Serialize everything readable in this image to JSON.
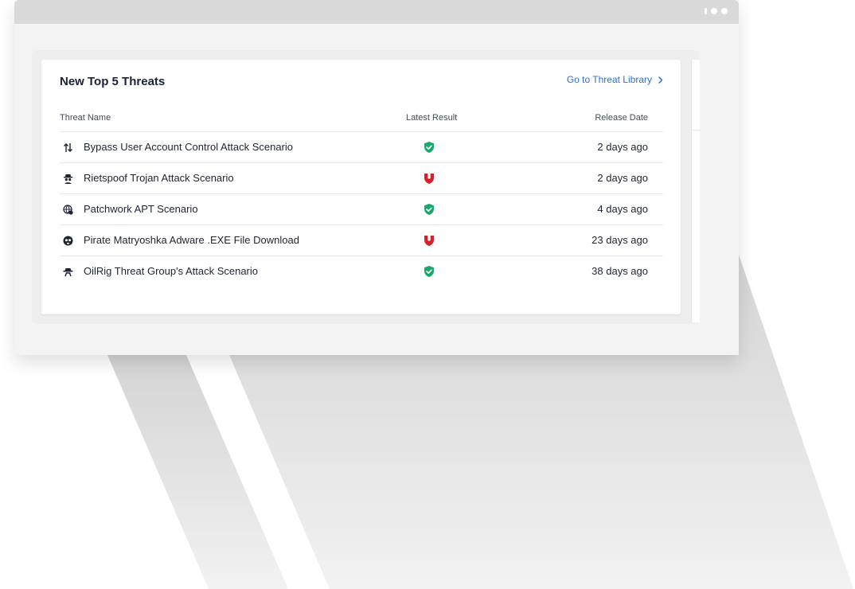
{
  "colors": {
    "accent_link": "#2f6fd6",
    "text_dark": "#1c2235",
    "prevented": "#18a86b",
    "not_prevented": "#d8202a"
  },
  "window": {
    "controls": [
      "dot-small",
      "dot",
      "dot"
    ]
  },
  "widget": {
    "title": "New Top 5 Threats",
    "link_label": "Go to Threat Library",
    "link_icon": "chevron-right-icon",
    "columns": {
      "name": "Threat Name",
      "result": "Latest Result",
      "date": "Release Date"
    },
    "rows": [
      {
        "icon": "arrows-up-down-icon",
        "name": "Bypass User Account Control Attack Scenario",
        "result": "prevented",
        "result_icon": "shield-check-icon",
        "date": "2 days ago"
      },
      {
        "icon": "spy-icon",
        "name": "Rietspoof Trojan Attack Scenario",
        "result": "not-prevented",
        "result_icon": "shield-open-icon",
        "date": "2 days ago"
      },
      {
        "icon": "globe-bug-icon",
        "name": "Patchwork APT Scenario",
        "result": "prevented",
        "result_icon": "shield-check-icon",
        "date": "4 days ago"
      },
      {
        "icon": "skull-icon",
        "name": "Pirate Matryoshka Adware .EXE File Download",
        "result": "not-prevented",
        "result_icon": "shield-open-icon",
        "date": "23 days ago"
      },
      {
        "icon": "hat-spy-icon",
        "name": "OilRig Threat Group's Attack Scenario",
        "result": "prevented",
        "result_icon": "shield-check-icon",
        "date": "38 days ago"
      }
    ]
  }
}
